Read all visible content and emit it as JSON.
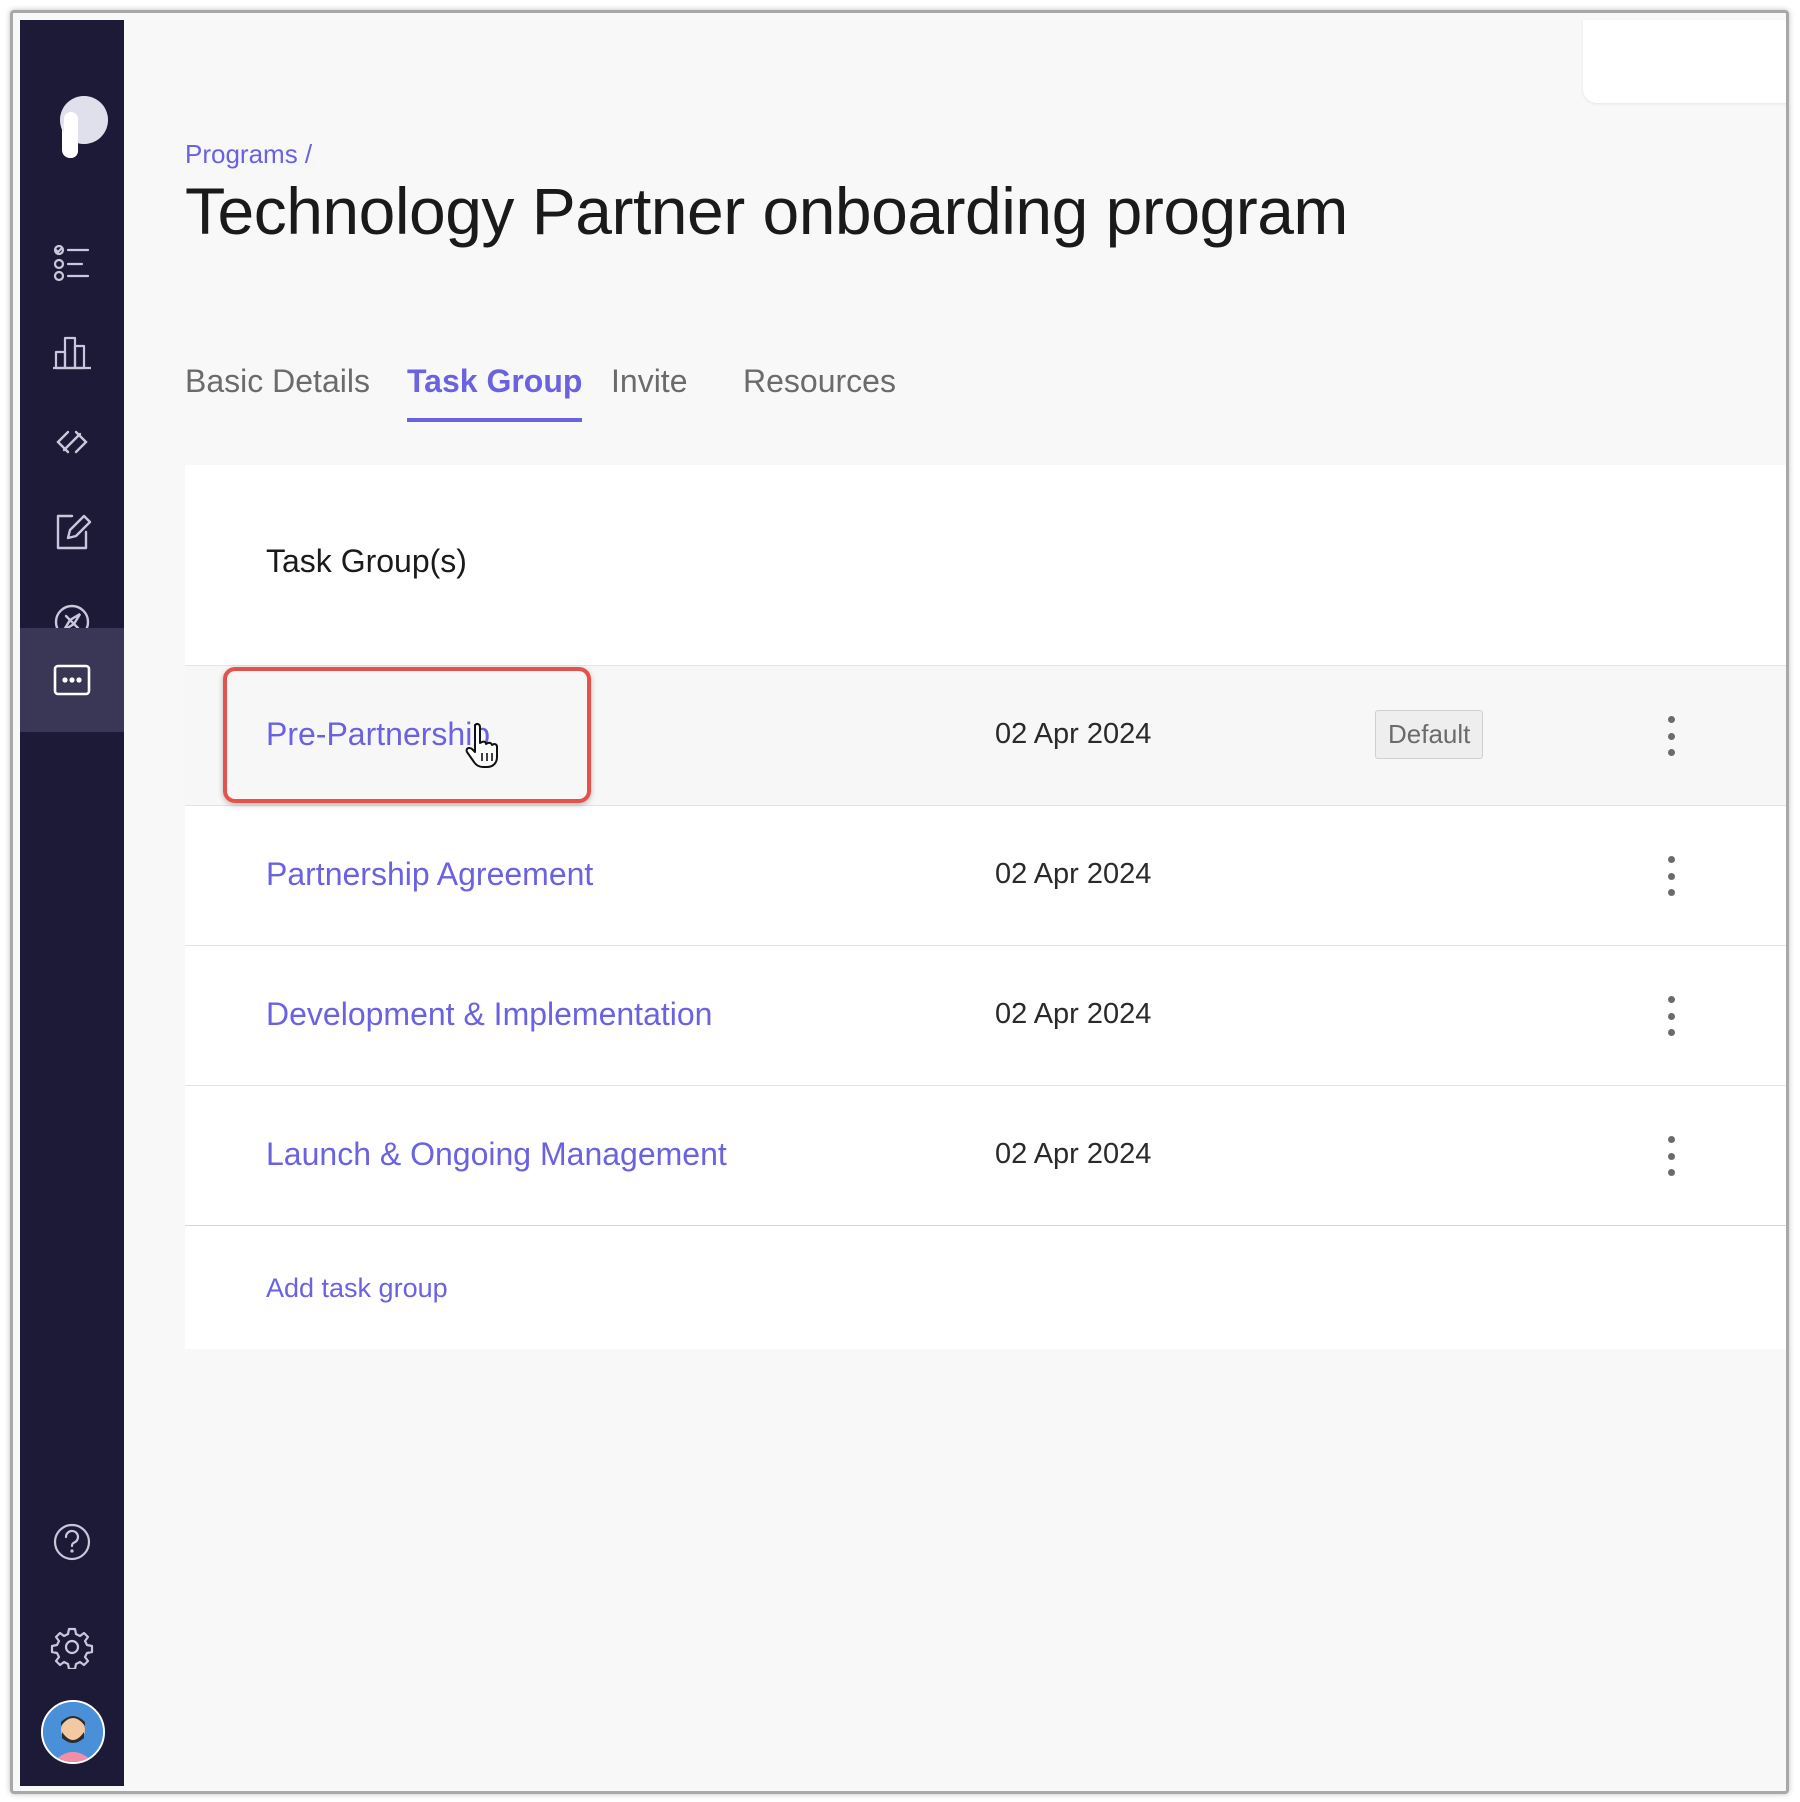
{
  "breadcrumb": "Programs /",
  "page_title": "Technology Partner onboarding program",
  "tabs": [
    {
      "label": "Basic Details",
      "active": false
    },
    {
      "label": "Task Group",
      "active": true
    },
    {
      "label": "Invite",
      "active": false
    },
    {
      "label": "Resources",
      "active": false
    }
  ],
  "card_title": "Task Group(s)",
  "task_groups": [
    {
      "name": "Pre-Partnership",
      "date": "02 Apr 2024",
      "badge": "Default"
    },
    {
      "name": "Partnership Agreement",
      "date": "02 Apr 2024"
    },
    {
      "name": "Development & Implementation",
      "date": "02 Apr 2024"
    },
    {
      "name": "Launch & Ongoing Management",
      "date": "02 Apr 2024"
    }
  ],
  "add_task_group": "Add task group",
  "sidebar_icons": [
    "checklist-icon",
    "bar-chart-icon",
    "link-icon",
    "edit-icon",
    "compass-icon",
    "more-box-icon"
  ],
  "bottom_icons": [
    "help-icon",
    "settings-icon"
  ],
  "colors": {
    "sidebar": "#1d1a38",
    "accent": "#6a62e0",
    "highlight": "#e5524a"
  }
}
